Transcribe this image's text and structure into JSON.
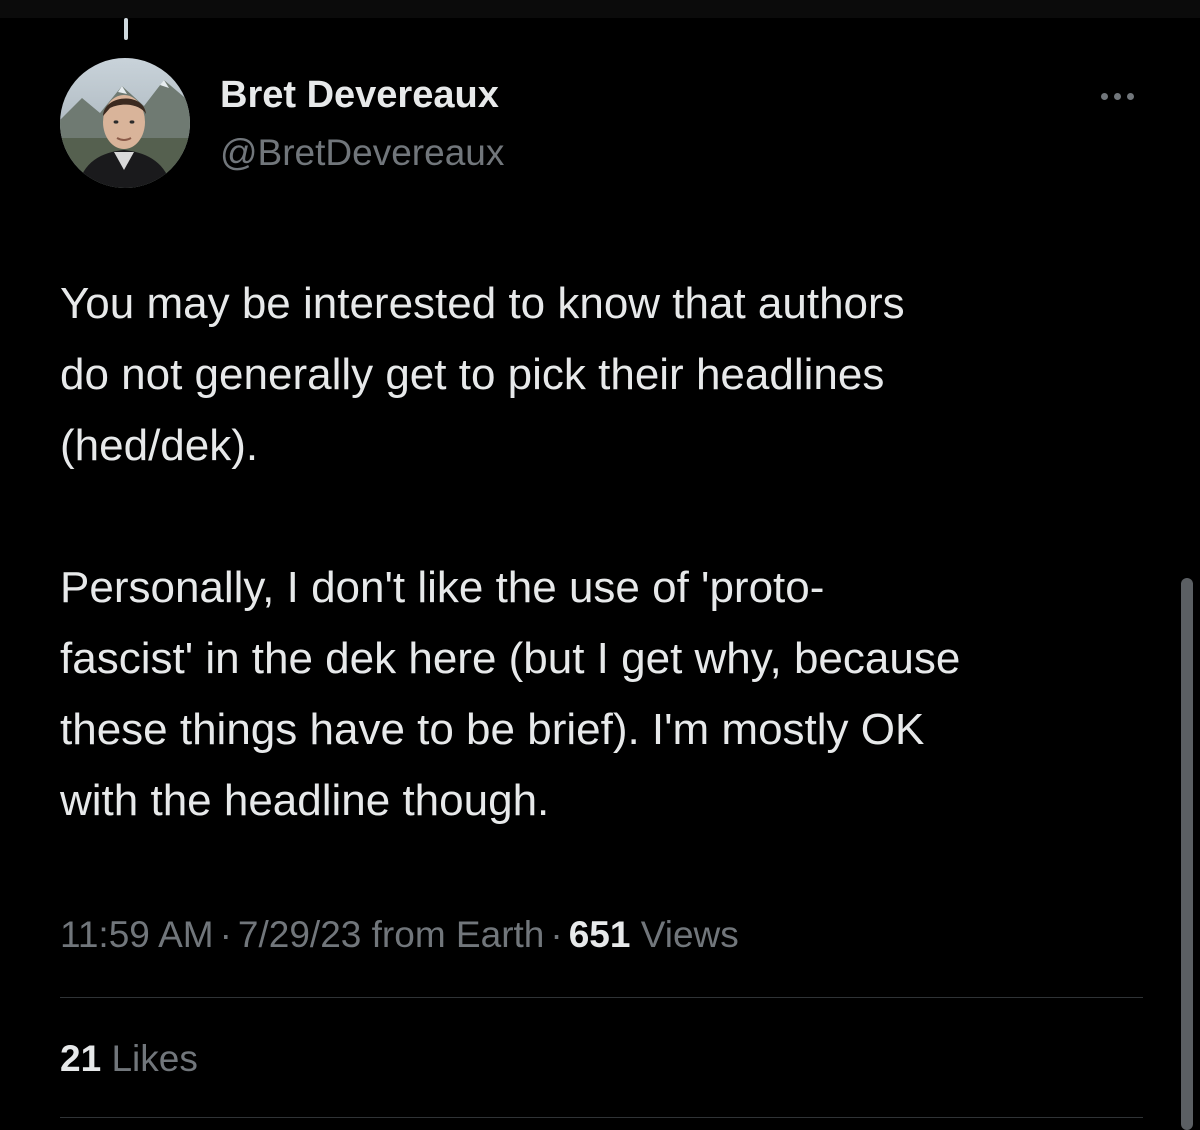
{
  "colors": {
    "background": "#000000",
    "primary_text": "#e7e9ea",
    "secondary_text": "#71767b",
    "divider": "#2f3336"
  },
  "author": {
    "display_name": "Bret Devereaux",
    "handle": "@BretDevereaux",
    "avatar_icon": "profile-photo"
  },
  "more_icon": "more-dots-icon",
  "tweet": {
    "paragraphs": [
      "You may be interested to know that authors\ndo not generally get to pick their headlines\n(hed/dek).",
      "Personally, I don't like the use of 'proto-\nfascist' in the dek here (but I get why, because\nthese things have to be brief).  I'm mostly OK\nwith the headline though."
    ]
  },
  "meta": {
    "time": "11:59 AM",
    "separator": "·",
    "date": "7/29/23",
    "source": "from Earth",
    "views_count": "651",
    "views_label": "Views"
  },
  "stats": {
    "likes_count": "21",
    "likes_label": "Likes"
  }
}
